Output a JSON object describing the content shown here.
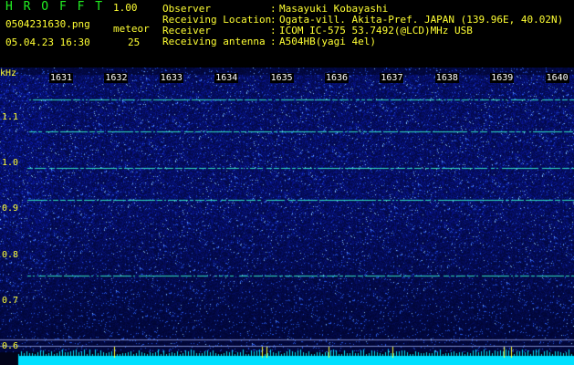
{
  "header": {
    "app_title": "HROFFT",
    "version": "1.00",
    "filename": "0504231630.png",
    "datetime": "05.04.23 16:30",
    "meteor_label": "meteor",
    "meteor_count": "25"
  },
  "info": [
    {
      "label": "Observer",
      "value": "Masayuki Kobayashi"
    },
    {
      "label": "Receiving Location",
      "value": "Ogata-vill. Akita-Pref. JAPAN (139.96E, 40.02N)"
    },
    {
      "label": "Receiver",
      "value": "ICOM IC-575 53.7492(@LCD)MHz USB"
    },
    {
      "label": "Receiving antenna",
      "value": "A504HB(yagi 4el)"
    }
  ],
  "chart_data": {
    "type": "heatmap",
    "ylabel": "kHz",
    "yticks": [
      "1.1",
      "1.0",
      "0.9",
      "0.8",
      "0.7",
      "0.6"
    ],
    "ylim": [
      0.59,
      1.17
    ],
    "x_minutes": [
      "1631",
      "1632",
      "1633",
      "1634",
      "1635",
      "1636",
      "1637",
      "1638",
      "1639",
      "1640"
    ],
    "carrier_lines_khz": [
      1.14,
      1.07,
      0.99,
      0.92,
      0.755
    ]
  },
  "colors": {
    "background": "#000000",
    "title_green": "#22ee22",
    "label_yellow": "#ffff33",
    "noise_blue": "#1a28b4",
    "carrier_cyan": "#30e0c0",
    "baseline_cyan": "#00e0ff"
  }
}
